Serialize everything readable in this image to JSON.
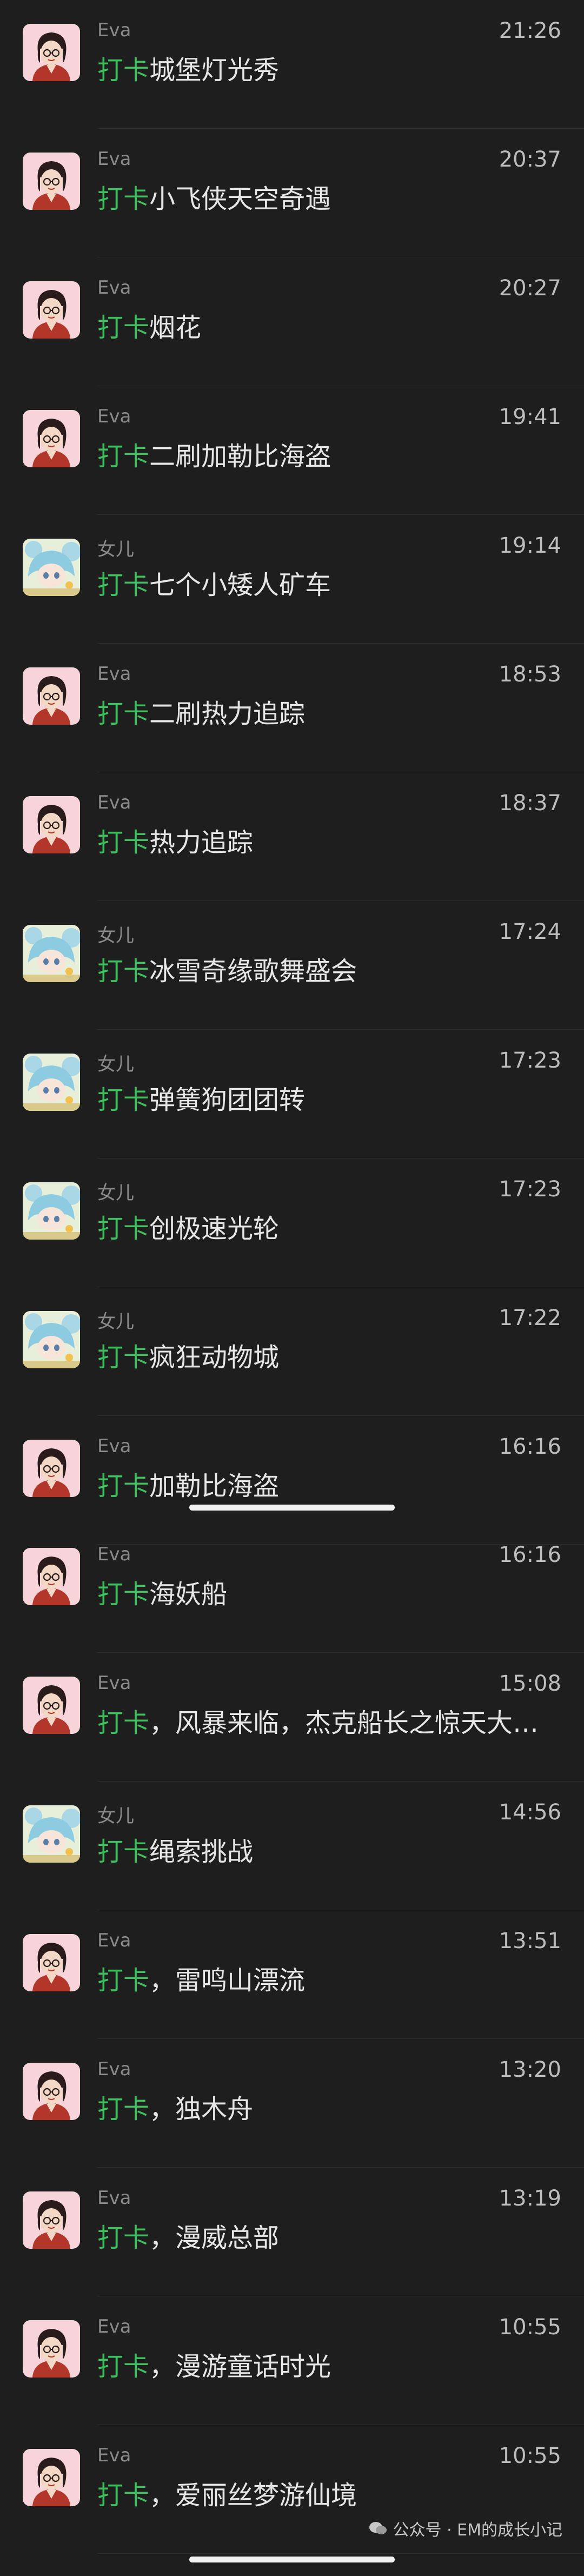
{
  "messages": [
    {
      "sender": "Eva",
      "avatar": "eva-avatar-icon",
      "time": "21:26",
      "tag": "打卡",
      "text": "城堡灯光秀"
    },
    {
      "sender": "Eva",
      "avatar": "eva-avatar-icon",
      "time": "20:37",
      "tag": "打卡",
      "text": "小飞侠天空奇遇"
    },
    {
      "sender": "Eva",
      "avatar": "eva-avatar-icon",
      "time": "20:27",
      "tag": "打卡",
      "text": "烟花"
    },
    {
      "sender": "Eva",
      "avatar": "eva-avatar-icon",
      "time": "19:41",
      "tag": "打卡",
      "text": "二刷加勒比海盗"
    },
    {
      "sender": "女儿",
      "avatar": "daughter-avatar-icon",
      "time": "19:14",
      "tag": "打卡",
      "text": "七个小矮人矿车"
    },
    {
      "sender": "Eva",
      "avatar": "eva-avatar-icon",
      "time": "18:53",
      "tag": "打卡",
      "text": "二刷热力追踪"
    },
    {
      "sender": "Eva",
      "avatar": "eva-avatar-icon",
      "time": "18:37",
      "tag": "打卡",
      "text": "热力追踪"
    },
    {
      "sender": "女儿",
      "avatar": "daughter-avatar-icon",
      "time": "17:24",
      "tag": "打卡",
      "text": "冰雪奇缘歌舞盛会"
    },
    {
      "sender": "女儿",
      "avatar": "daughter-avatar-icon",
      "time": "17:23",
      "tag": "打卡",
      "text": "弹簧狗团团转"
    },
    {
      "sender": "女儿",
      "avatar": "daughter-avatar-icon",
      "time": "17:23",
      "tag": "打卡",
      "text": "创极速光轮"
    },
    {
      "sender": "女儿",
      "avatar": "daughter-avatar-icon",
      "time": "17:22",
      "tag": "打卡",
      "text": "疯狂动物城"
    },
    {
      "sender": "Eva",
      "avatar": "eva-avatar-icon",
      "time": "16:16",
      "tag": "打卡",
      "text": "加勒比海盗"
    },
    {
      "sender": "Eva",
      "avatar": "eva-avatar-icon",
      "time": "16:16",
      "tag": "打卡",
      "text": "海妖船"
    },
    {
      "sender": "Eva",
      "avatar": "eva-avatar-icon",
      "time": "15:08",
      "tag": "打卡",
      "text": "，风暴来临，杰克船长之惊天大…"
    },
    {
      "sender": "女儿",
      "avatar": "daughter-avatar-icon",
      "time": "14:56",
      "tag": "打卡",
      "text": "绳索挑战"
    },
    {
      "sender": "Eva",
      "avatar": "eva-avatar-icon",
      "time": "13:51",
      "tag": "打卡",
      "text": "，雷鸣山漂流"
    },
    {
      "sender": "Eva",
      "avatar": "eva-avatar-icon",
      "time": "13:20",
      "tag": "打卡",
      "text": "，独木舟"
    },
    {
      "sender": "Eva",
      "avatar": "eva-avatar-icon",
      "time": "13:19",
      "tag": "打卡",
      "text": "，漫威总部"
    },
    {
      "sender": "Eva",
      "avatar": "eva-avatar-icon",
      "time": "10:55",
      "tag": "打卡",
      "text": "，漫游童话时光"
    },
    {
      "sender": "Eva",
      "avatar": "eva-avatar-icon",
      "time": "10:55",
      "tag": "打卡",
      "text": "，爱丽丝梦游仙境"
    }
  ],
  "watermark": {
    "text": "公众号 · EM的成长小记",
    "icon": "wechat-official-account-icon"
  },
  "colors": {
    "background": "#1e1e1e",
    "tag": "#3fbf5f",
    "name": "#8a8a8a",
    "time": "#bdbdbd",
    "text": "#e6e6e6"
  }
}
